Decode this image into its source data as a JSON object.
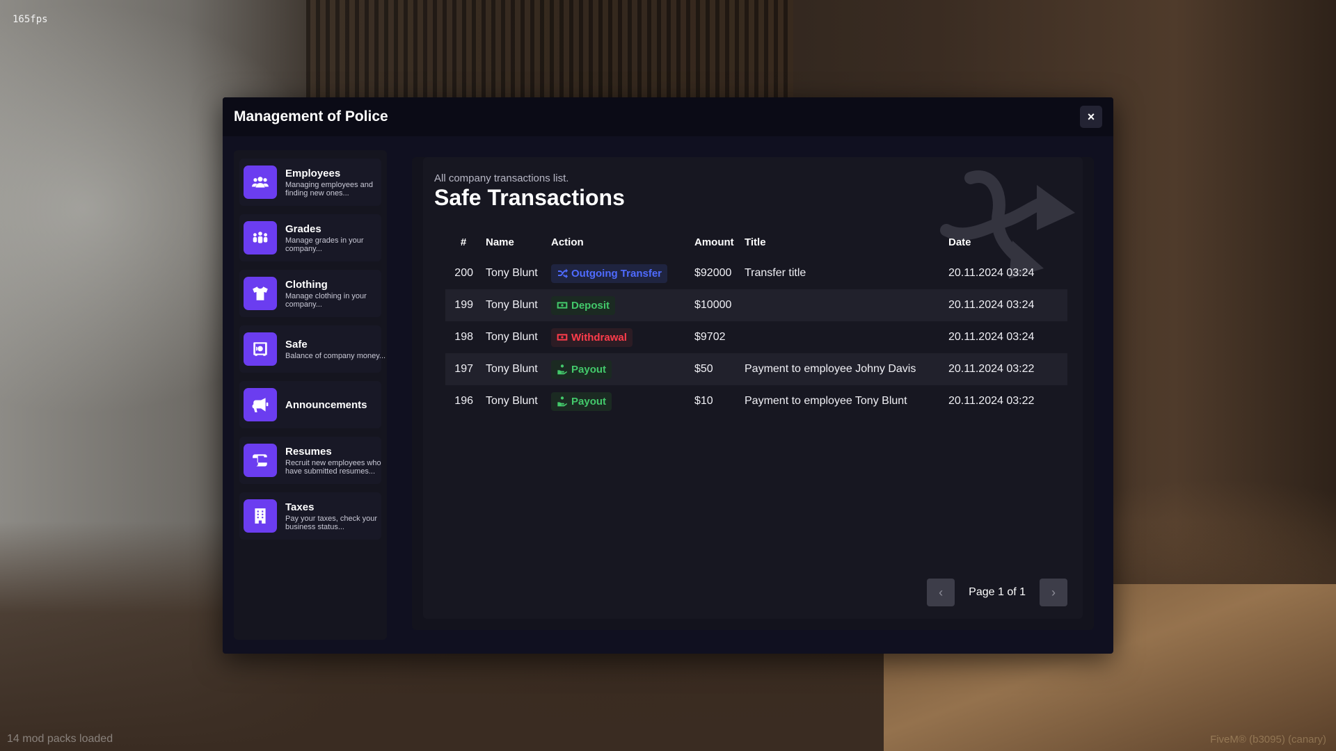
{
  "hud": {
    "fps": "165fps",
    "mod_packs": "14 mod packs loaded",
    "build": "FiveM® (b3095) (canary)"
  },
  "window": {
    "title": "Management of Police",
    "close_label": "×"
  },
  "sidebar": {
    "items": [
      {
        "label": "Employees",
        "desc": "Managing employees and finding new ones...",
        "icon": "users-icon"
      },
      {
        "label": "Grades",
        "desc": "Manage grades in your company...",
        "icon": "group-icon"
      },
      {
        "label": "Clothing",
        "desc": "Manage clothing in your company...",
        "icon": "shirt-icon"
      },
      {
        "label": "Safe",
        "desc": "Balance of company money...",
        "icon": "safe-icon"
      },
      {
        "label": "Announcements",
        "desc": "",
        "icon": "megaphone-icon"
      },
      {
        "label": "Resumes",
        "desc": "Recruit new employees who have submitted resumes...",
        "icon": "scroll-icon"
      },
      {
        "label": "Taxes",
        "desc": "Pay your taxes, check your business status...",
        "icon": "building-icon"
      }
    ]
  },
  "main": {
    "subtitle": "All company transactions list.",
    "heading": "Safe Transactions",
    "columns": {
      "id": "#",
      "name": "Name",
      "action": "Action",
      "amount": "Amount",
      "title": "Title",
      "date": "Date"
    },
    "rows": [
      {
        "id": "200",
        "name": "Tony Blunt",
        "action": "Outgoing Transfer",
        "action_type": "transfer",
        "amount": "$92000",
        "title": "Transfer title",
        "date": "20.11.2024 03:24"
      },
      {
        "id": "199",
        "name": "Tony Blunt",
        "action": "Deposit",
        "action_type": "deposit",
        "amount": "$10000",
        "title": "",
        "date": "20.11.2024 03:24"
      },
      {
        "id": "198",
        "name": "Tony Blunt",
        "action": "Withdrawal",
        "action_type": "withdrawal",
        "amount": "$9702",
        "title": "",
        "date": "20.11.2024 03:24"
      },
      {
        "id": "197",
        "name": "Tony Blunt",
        "action": "Payout",
        "action_type": "payout",
        "amount": "$50",
        "title": "Payment to employee Johny Davis",
        "date": "20.11.2024 03:22"
      },
      {
        "id": "196",
        "name": "Tony Blunt",
        "action": "Payout",
        "action_type": "payout",
        "amount": "$10",
        "title": "Payment to employee Tony Blunt",
        "date": "20.11.2024 03:22"
      }
    ],
    "pager": {
      "label": "Page 1 of 1",
      "prev": "‹",
      "next": "›"
    }
  },
  "colors": {
    "accent": "#6b3df0",
    "transfer": "#4f6bff",
    "deposit": "#43c96b",
    "withdrawal": "#ff3c4b",
    "payout": "#43c96b"
  }
}
